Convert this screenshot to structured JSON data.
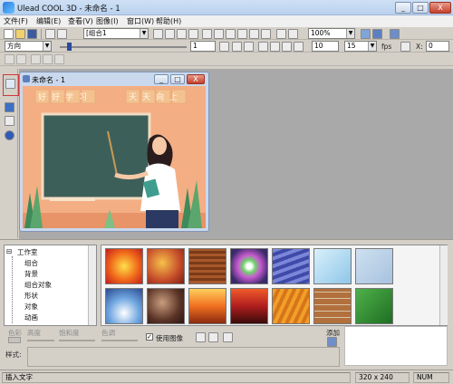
{
  "window": {
    "title": "Ulead COOL 3D - 未命名 - 1",
    "controls": [
      "_",
      "□",
      "X"
    ]
  },
  "menu": [
    "文件(F)",
    "编辑(E)",
    "查看(V)",
    "图像(I)",
    "窗口(W)",
    "帮助(H)"
  ],
  "toolbar1": {
    "object_select": "[组合1",
    "zoom": "100%"
  },
  "toolbar2": {
    "mode": "方向",
    "frame": "1",
    "frames": "10",
    "fps_value": "15",
    "fps_label": "fps",
    "x_label": "X:",
    "x_value": "0"
  },
  "document": {
    "title": "未命名 - 1",
    "banner_left": "好好学习",
    "banner_right": "天天向上"
  },
  "tree": {
    "root": "工作室",
    "items": [
      "组合",
      "背景",
      "组合对象",
      "形状",
      "对象",
      "动画"
    ]
  },
  "gallery_options": {
    "use_image": "使用图像",
    "add": "添加",
    "color_labels": [
      "色彩",
      "高度",
      "饱和度",
      "色调"
    ],
    "style_label": "样式:"
  },
  "status": {
    "hint": "插入文字",
    "size": "320 x 240",
    "num": "NUM"
  },
  "colors": {
    "accent": "#d0383b",
    "chalkboard": "#3d5f5a",
    "canvas_bg": "#f4ae84"
  }
}
